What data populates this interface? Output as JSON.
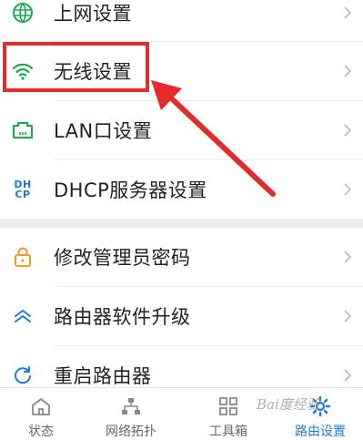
{
  "colors": {
    "accent": "#1f7ad6",
    "wifi_green": "#1aa84f",
    "orange": "#f29a2e",
    "highlight_red": "#e32b2b",
    "chevron": "#b8b8b8"
  },
  "menu": {
    "group1": [
      {
        "label": "上网设置",
        "icon": "globe-icon"
      },
      {
        "label": "无线设置",
        "icon": "wifi-icon"
      },
      {
        "label": "LAN口设置",
        "icon": "lan-port-icon"
      },
      {
        "label": "DHCP服务器设置",
        "icon": "dhcp-icon",
        "icon_text_top": "DH",
        "icon_text_bottom": "CP"
      }
    ],
    "group2": [
      {
        "label": "修改管理员密码",
        "icon": "lock-icon"
      },
      {
        "label": "路由器软件升级",
        "icon": "upgrade-icon"
      },
      {
        "label": "重启路由器",
        "icon": "restart-icon"
      }
    ]
  },
  "tabbar": {
    "tabs": [
      {
        "label": "状态",
        "icon": "home-icon"
      },
      {
        "label": "网络拓扑",
        "icon": "topology-icon"
      },
      {
        "label": "工具箱",
        "icon": "toolbox-icon"
      },
      {
        "label": "路由设置",
        "icon": "router-settings-icon",
        "active": true
      }
    ]
  },
  "watermark": "Bai度经验"
}
